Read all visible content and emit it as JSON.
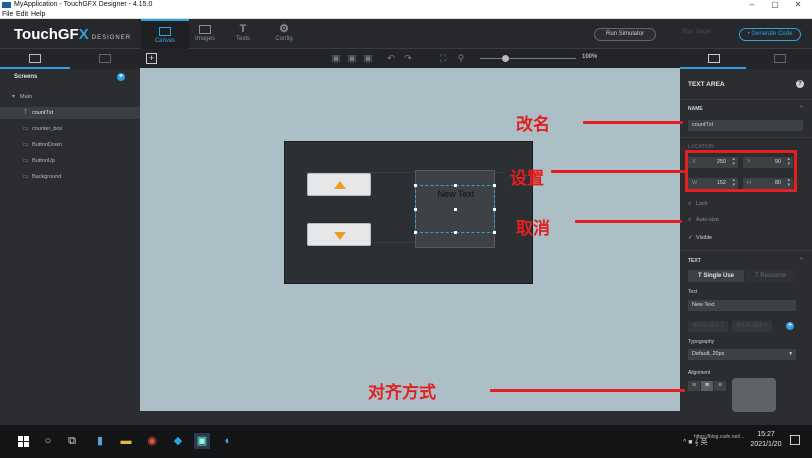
{
  "window": {
    "title": "MyApplication - TouchGFX Designer - 4.15.0",
    "controls": [
      "–",
      "▢",
      "✕"
    ]
  },
  "menu": [
    "File",
    "Edit",
    "Help"
  ],
  "header": {
    "brand_main": "TouchGF",
    "brand_x": "X",
    "brand_sub": "DESIGNER",
    "tabs": [
      {
        "label": "Canvas",
        "icon": "canvas-icon",
        "active": true
      },
      {
        "label": "Images",
        "icon": "images-icon",
        "active": false
      },
      {
        "label": "Texts",
        "icon": "texts-icon",
        "glyph": "T",
        "active": false
      },
      {
        "label": "Config",
        "icon": "config-icon",
        "glyph": "⚙",
        "active": false
      }
    ],
    "run_simulator": "Run Simulator",
    "run_target": "Run Target",
    "generate_code": "Generate Code"
  },
  "left_panel": {
    "screens_label": "Screens",
    "add": "+",
    "tree": [
      {
        "label": "Main",
        "icon": "▾",
        "indent": 0,
        "selected": false
      },
      {
        "label": "countTxt",
        "icon": "T",
        "indent": 1,
        "selected": true
      },
      {
        "label": "counter_box",
        "icon": "▭",
        "indent": 1,
        "selected": false
      },
      {
        "label": "ButtonDown",
        "icon": "▭",
        "indent": 1,
        "selected": false
      },
      {
        "label": "ButtonUp",
        "icon": "▭",
        "indent": 1,
        "selected": false
      },
      {
        "label": "Background",
        "icon": "▭",
        "indent": 1,
        "selected": false
      }
    ]
  },
  "toolbar": {
    "add_widget": "+",
    "zoom": "100%"
  },
  "canvas": {
    "text_area_text": "New Text"
  },
  "right_panel": {
    "title": "TEXT AREA",
    "help": "?",
    "name_section": "NAME",
    "name_value": "countTxt",
    "location_section": "LOCATION",
    "x_label": "X",
    "x_value": "250",
    "y_label": "Y",
    "y_value": "90",
    "w_label": "W",
    "w_value": "152",
    "h_label": "H",
    "h_value": "80",
    "lock": "Lock",
    "auto_size": "Auto-size",
    "visible": "Visible",
    "text_section": "TEXT",
    "single_use": "Single Use",
    "resource": "Resource",
    "text_label": "Text",
    "text_value": "New Text",
    "wildcard1": "WILDCARD 1",
    "wildcard2": "WILDCARD 2",
    "typography_label": "Typography",
    "typography_value": "Default, 20px",
    "alignment_label": "Alignment",
    "align_left": "≡",
    "align_center": "≡",
    "align_right": "≡"
  },
  "annotations": {
    "rename": "改名",
    "settings": "设置",
    "cancel": "取消",
    "alignment": "对齐方式",
    "color": "#e32020"
  },
  "taskbar": {
    "tray": "^ ■ 𝄞 英",
    "time": "15:27",
    "date": "2021/1/20",
    "watermark": "https://blog.csdn.net/..."
  }
}
